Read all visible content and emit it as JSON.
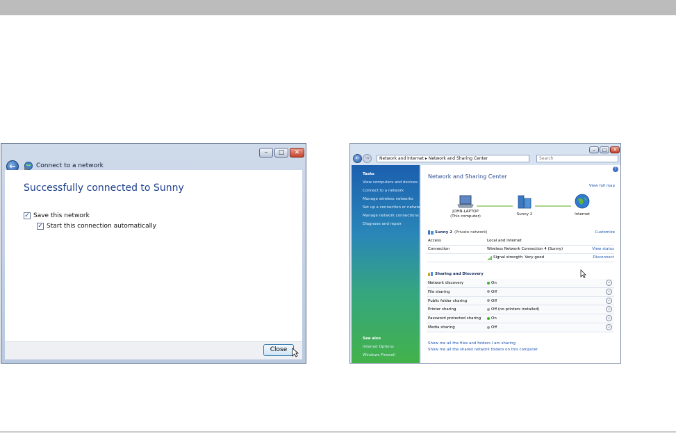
{
  "dialog": {
    "title": "Connect to a network",
    "heading": "Successfully connected to Sunny",
    "save_network_label": "Save this network",
    "start_auto_label": "Start this connection automatically",
    "close_button": "Close",
    "minimize_glyph": "–",
    "maximize_glyph": "□",
    "close_glyph": "✕"
  },
  "window": {
    "address_parts": [
      "Network and Internet",
      "Network and Sharing Center"
    ],
    "address_separator": "▸",
    "search_placeholder": "Search",
    "sidebar": {
      "tasks_heading": "Tasks",
      "tasks": [
        "View computers and devices",
        "Connect to a network",
        "Manage wireless networks",
        "Set up a connection or network",
        "Manage network connections",
        "Diagnose and repair"
      ],
      "see_also_heading": "See also",
      "see_also": [
        "Internet Options",
        "Windows Firewall"
      ]
    },
    "content": {
      "title": "Network and Sharing Center",
      "view_full_map": "View full map",
      "map": {
        "computer": "JOHN-LAPTOP",
        "computer_sub": "(This computer)",
        "network": "Sunny  2",
        "internet": "Internet"
      },
      "network_name": "Sunny  2",
      "network_type": "(Private network)",
      "customize": "Customize",
      "access_label": "Access",
      "access_value": "Local and Internet",
      "connection_label": "Connection",
      "connection_value": "Wireless Network Connection 4 (Sunny)",
      "view_status": "View status",
      "signal_text": "Signal strength: Very good",
      "disconnect": "Disconnect",
      "sharing_heading": "Sharing and Discovery",
      "sharing": [
        {
          "label": "Network discovery",
          "status": "On"
        },
        {
          "label": "File sharing",
          "status": "Off"
        },
        {
          "label": "Public folder sharing",
          "status": "Off"
        },
        {
          "label": "Printer sharing",
          "status": "Off (no printers installed)"
        },
        {
          "label": "Password protected sharing",
          "status": "On"
        },
        {
          "label": "Media sharing",
          "status": "Off"
        }
      ],
      "footer_links": [
        "Show me all the files and folders I am sharing",
        "Show me all the shared network folders on this computer"
      ]
    }
  },
  "colors": {
    "on": "#3fae2a",
    "off": "#9aa0a6",
    "accent": "#1c3e8b"
  }
}
